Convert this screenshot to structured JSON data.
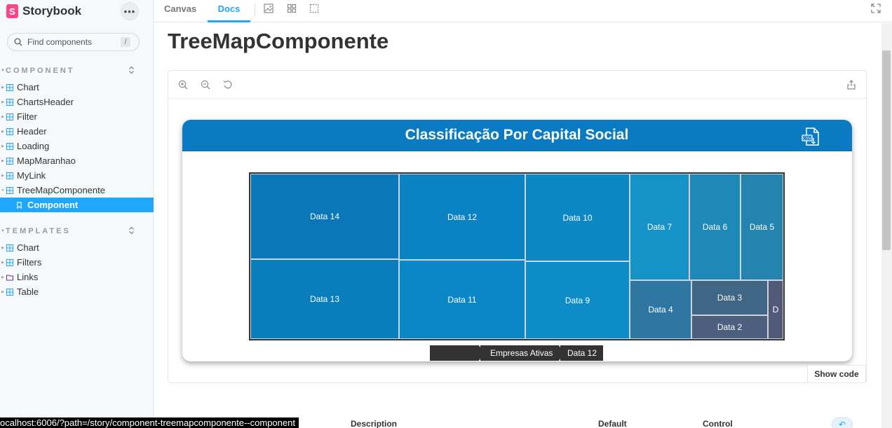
{
  "sidebar": {
    "brand": "Storybook",
    "brand_glyph": "S",
    "menu_label": "•••",
    "search_placeholder": "Find components",
    "search_shortcut": "/",
    "sections": [
      {
        "title": "COMPONENT",
        "items": [
          {
            "label": "Chart",
            "icon": "component-icon"
          },
          {
            "label": "ChartsHeader",
            "icon": "component-icon"
          },
          {
            "label": "Filter",
            "icon": "component-icon"
          },
          {
            "label": "Header",
            "icon": "component-icon"
          },
          {
            "label": "Loading",
            "icon": "component-icon"
          },
          {
            "label": "MapMaranhao",
            "icon": "component-icon"
          },
          {
            "label": "MyLink",
            "icon": "component-icon"
          },
          {
            "label": "TreeMapComponente",
            "icon": "component-icon"
          }
        ],
        "selected_child": "Component"
      },
      {
        "title": "TEMPLATES",
        "items": [
          {
            "label": "Chart",
            "icon": "component-icon"
          },
          {
            "label": "Filters",
            "icon": "component-icon"
          },
          {
            "label": "Links",
            "icon": "folder-icon"
          },
          {
            "label": "Table",
            "icon": "component-icon"
          }
        ]
      }
    ]
  },
  "toolbar": {
    "tabs": [
      {
        "label": "Canvas",
        "active": false
      },
      {
        "label": "Docs",
        "active": true
      }
    ]
  },
  "docs": {
    "title": "TreeMapComponente",
    "show_code": "Show code",
    "card": {
      "title": "Classificação Por Capital Social",
      "header_color": "#0a7bc2"
    },
    "breadcrumbs": [
      "",
      "Empresas Ativas",
      "Data 12"
    ],
    "args_headers": [
      "Description",
      "Default",
      "Control"
    ]
  },
  "chart_data": {
    "type": "treemap",
    "cells": [
      {
        "label": "Data 14",
        "color": "#0a78b8"
      },
      {
        "label": "Data 13",
        "color": "#0a7ebd"
      },
      {
        "label": "Data 12",
        "color": "#0b82c1"
      },
      {
        "label": "Data 11",
        "color": "#0b87c5"
      },
      {
        "label": "Data 10",
        "color": "#0c89c5"
      },
      {
        "label": "Data 9",
        "color": "#0d8dc8"
      },
      {
        "label": "Data 7",
        "color": "#1593c7"
      },
      {
        "label": "Data 6",
        "color": "#1e89b7"
      },
      {
        "label": "Data 5",
        "color": "#2584ae"
      },
      {
        "label": "Data 4",
        "color": "#2e77a0"
      },
      {
        "label": "Data 3",
        "color": "#3f6685"
      },
      {
        "label": "Data 2",
        "color": "#4d5f7e"
      },
      {
        "label": "D",
        "color": "#535a78"
      }
    ]
  },
  "status_bar": {
    "url": "ocalhost:6006/?path=/story/component-treemapcomponente--component"
  }
}
